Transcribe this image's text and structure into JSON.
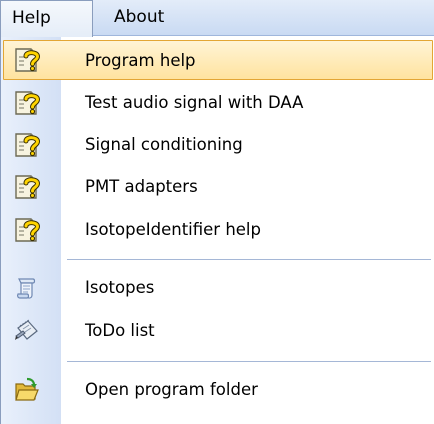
{
  "menubar": {
    "items": [
      {
        "label": "Help"
      },
      {
        "label": "About"
      }
    ]
  },
  "help_menu": {
    "items": [
      {
        "label": "Program help",
        "icon": "help-document-icon"
      },
      {
        "label": "Test audio signal with DAA",
        "icon": "help-document-icon"
      },
      {
        "label": "Signal conditioning",
        "icon": "help-document-icon"
      },
      {
        "label": "PMT adapters",
        "icon": "help-document-icon"
      },
      {
        "label": "IsotopeIdentifier help",
        "icon": "help-document-icon"
      },
      {
        "label": "Isotopes",
        "icon": "scroll-icon"
      },
      {
        "label": "ToDo list",
        "icon": "notepad-pencil-icon"
      },
      {
        "label": "Open program folder",
        "icon": "open-folder-icon"
      }
    ]
  },
  "colors": {
    "menubar_bg": "#c9daf3",
    "gutter_bg": "#d3e0f5",
    "highlight_bg": "#ffe39f",
    "highlight_border": "#e3a635",
    "separator": "#a5b7d6"
  }
}
